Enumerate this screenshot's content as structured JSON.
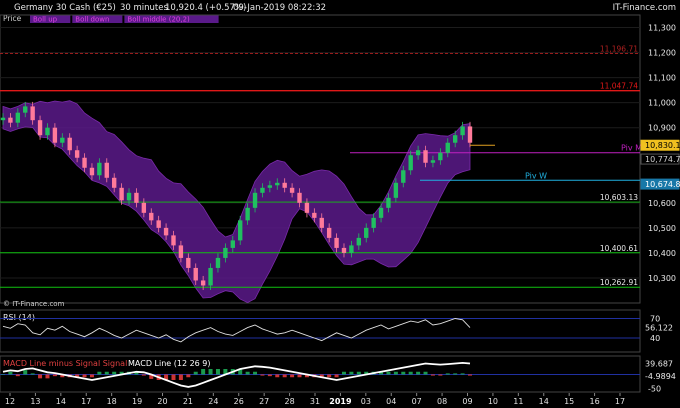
{
  "header": {
    "instrument": "Germany 30 Cash (€25)",
    "timeframe": "30 minutes",
    "price_change": "10,920.4 (+0.57%)",
    "datetime": "09-Jan-2019 08:22:32",
    "brand": "IT-Finance.com"
  },
  "legend": {
    "price_label": "Price",
    "band_labels": [
      "Boll up",
      "Boll down",
      "Boll middle (20,2)"
    ]
  },
  "copyright": "© IT-Finance.com",
  "chart_data": [
    {
      "type": "candlestick",
      "panel": "price",
      "ylim": [
        10200,
        11350
      ],
      "y_ticks": [
        "11,300",
        "11,200",
        "11,100",
        "11,000",
        "10,900",
        "10,600",
        "10,500",
        "10,400",
        "10,300"
      ],
      "x_ticks": [
        "12",
        "13",
        "14",
        "17",
        "18",
        "19",
        "20",
        "21",
        "24",
        "26",
        "27",
        "28",
        "31",
        "2019",
        "03",
        "04",
        "07",
        "08",
        "09",
        "10",
        "11",
        "14",
        "15",
        "16",
        "17"
      ],
      "close": [
        10940,
        10920,
        10960,
        10985,
        10930,
        10870,
        10900,
        10840,
        10860,
        10810,
        10780,
        10740,
        10710,
        10760,
        10700,
        10660,
        10610,
        10640,
        10600,
        10560,
        10530,
        10500,
        10470,
        10430,
        10380,
        10340,
        10290,
        10270,
        10340,
        10380,
        10420,
        10450,
        10530,
        10580,
        10640,
        10660,
        10670,
        10680,
        10660,
        10640,
        10600,
        10560,
        10540,
        10500,
        10460,
        10420,
        10400,
        10430,
        10460,
        10500,
        10540,
        10580,
        10620,
        10680,
        10730,
        10790,
        10810,
        10760,
        10770,
        10800,
        10840,
        10870,
        10905,
        10840
      ],
      "levels": [
        {
          "value": 11196.71,
          "label": "11,196.71",
          "color": "#b02020",
          "style": "dashed"
        },
        {
          "value": 11047.74,
          "label": "11,047.74",
          "color": "#e01818",
          "style": "solid"
        },
        {
          "value": 10603.13,
          "label": "10,603.13",
          "color": "#10c010",
          "style": "solid"
        },
        {
          "value": 10400.61,
          "label": "10,400.61",
          "color": "#10c010",
          "style": "solid"
        },
        {
          "value": 10262.91,
          "label": "10,262.91",
          "color": "#10c010",
          "style": "solid"
        }
      ],
      "pivots": [
        {
          "name": "Piv M",
          "value": 10800,
          "color": "#c020c0"
        },
        {
          "name": "Piv W",
          "value": 10690,
          "color": "#20b0e0"
        }
      ],
      "price_tags": [
        {
          "label": "10,830.1",
          "value": 10830,
          "bg": "#f0c020",
          "fg": "#000000"
        },
        {
          "label": "10,774.7",
          "value": 10774.7,
          "bg": "#000000",
          "fg": "#d0d0d0"
        },
        {
          "label": "10,674.8",
          "value": 10674.8,
          "bg": "#1878a8",
          "fg": "#ffffff"
        }
      ],
      "colors": {
        "up": "#20c060",
        "down": "#ff7a9a",
        "band": "#5a1a8a"
      }
    },
    {
      "type": "line",
      "panel": "rsi",
      "title": "RSI (14)",
      "ylim": [
        20,
        80
      ],
      "y_ticks": [
        "70",
        "40"
      ],
      "values": [
        58,
        55,
        62,
        60,
        48,
        45,
        55,
        52,
        58,
        50,
        46,
        42,
        48,
        55,
        50,
        44,
        40,
        46,
        52,
        48,
        44,
        40,
        45,
        38,
        34,
        42,
        48,
        52,
        56,
        50,
        46,
        44,
        50,
        56,
        60,
        54,
        50,
        46,
        48,
        52,
        48,
        44,
        40,
        36,
        42,
        48,
        44,
        40,
        46,
        52,
        56,
        60,
        54,
        58,
        62,
        66,
        64,
        68,
        60,
        62,
        66,
        70,
        68,
        56
      ],
      "last_value": "56.122",
      "color": "#e0e0e0"
    },
    {
      "type": "histogram",
      "panel": "macd",
      "title": "MACD Line minus Signal Signal",
      "series": [
        {
          "name": "MACD Line (12 26 9)",
          "color": "#ffffff"
        }
      ],
      "ylim": [
        -60,
        60
      ],
      "y_ticks": [
        "-50"
      ],
      "labels": [
        {
          "text": "39.687"
        },
        {
          "text": "-4.9894"
        }
      ],
      "values": [
        10,
        15,
        12,
        20,
        22,
        15,
        8,
        5,
        0,
        -5,
        -10,
        -15,
        -20,
        -15,
        -10,
        -5,
        0,
        5,
        10,
        8,
        0,
        -10,
        -20,
        -30,
        -40,
        -45,
        -40,
        -30,
        -20,
        -10,
        0,
        10,
        20,
        25,
        30,
        28,
        25,
        20,
        15,
        10,
        5,
        0,
        -5,
        -10,
        -15,
        -20,
        -15,
        -10,
        -5,
        0,
        5,
        10,
        15,
        20,
        25,
        30,
        35,
        40,
        38,
        36,
        38,
        40,
        42,
        40
      ],
      "colors": {
        "up": "#20c060",
        "down": "#ff4040"
      }
    }
  ]
}
